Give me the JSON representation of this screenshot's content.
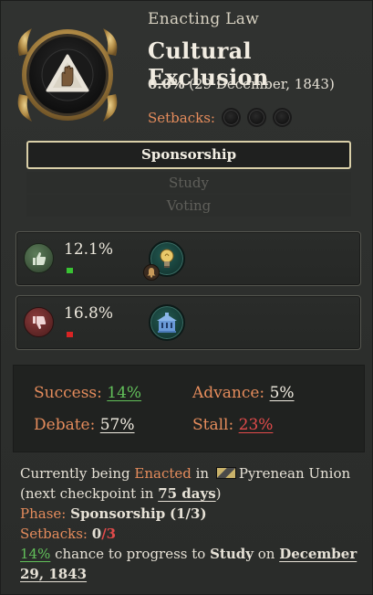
{
  "header": {
    "subtitle": "Enacting Law",
    "title": "Cultural Exclusion",
    "progress_pct": "0.0%",
    "progress_date": "(29 December, 1843)",
    "setbacks_label": "Setbacks:",
    "setbacks_total": 3,
    "setbacks_filled": 0,
    "emblem_icon": "raised-hand-warning-icon"
  },
  "phases": {
    "active": "Sponsorship",
    "next": [
      "Study",
      "Voting"
    ]
  },
  "support": {
    "value": "12.1%",
    "icon": "thumbs-up-icon",
    "group_icon": "lightbulb-intelligentsia-icon",
    "badge_icon": "bell-badge-icon"
  },
  "oppose": {
    "value": "16.8%",
    "icon": "thumbs-down-icon",
    "group_icon": "building-institution-icon"
  },
  "chances": {
    "success_label": "Success:",
    "success_value": "14%",
    "advance_label": "Advance:",
    "advance_value": "5%",
    "debate_label": "Debate:",
    "debate_value": "57%",
    "stall_label": "Stall:",
    "stall_value": "23%"
  },
  "info": {
    "line1_pre": "Currently being ",
    "line1_enacted": "Enacted",
    "line1_in": " in ",
    "country": "Pyrenean Union",
    "line1_post": " (next checkpoint in ",
    "checkpoint": "75 days",
    "line1_close": ")",
    "phase_label": "Phase:",
    "phase_value": "Sponsorship",
    "phase_count": "(1/3)",
    "setbacks_label": "Setbacks:",
    "setbacks_current": "0",
    "setbacks_max": "/3",
    "chance_value": "14%",
    "chance_text": " chance to progress to ",
    "chance_target": "Study",
    "chance_on": " on ",
    "chance_date": "December 29, 1843"
  },
  "colors": {
    "accent_orange": "#e58c5c",
    "positive_green": "#62c05a",
    "negative_red": "#e24b4b",
    "gold_frame": "#c9a25a"
  }
}
